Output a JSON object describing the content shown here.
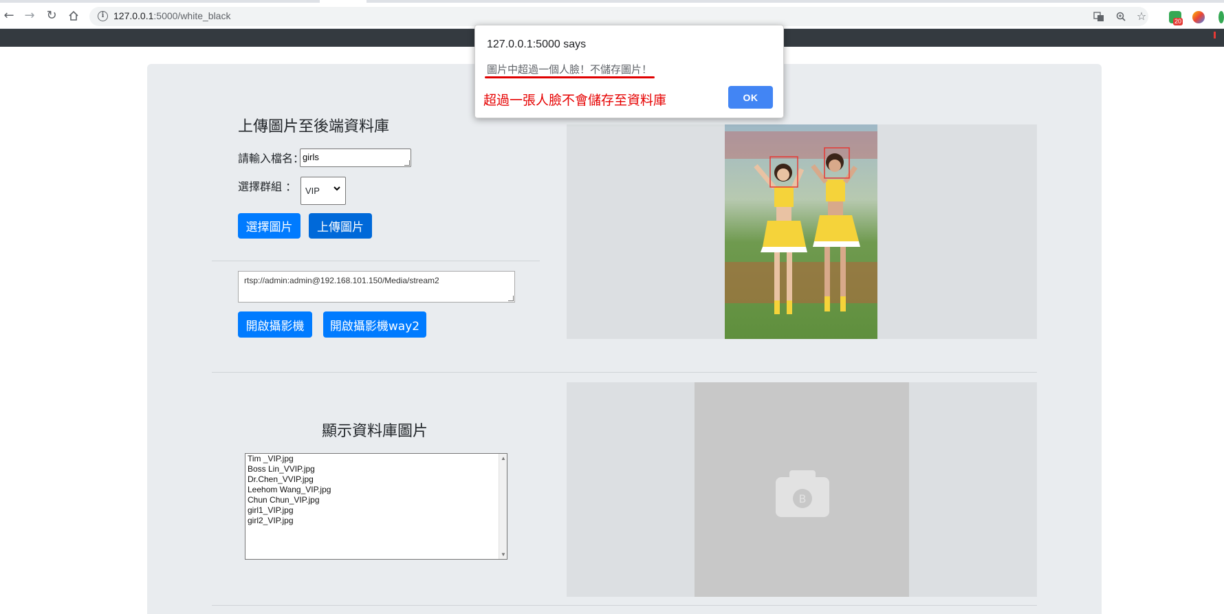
{
  "browser": {
    "url_host": "127.0.0.1",
    "url_path": ":5000/white_black",
    "extension_badge": "20",
    "icons": [
      "back-arrow-icon",
      "forward-arrow-icon",
      "reload-icon",
      "home-icon",
      "info-icon",
      "translate-icon",
      "zoom-icon",
      "star-icon"
    ]
  },
  "upload_section": {
    "title": "上傳圖片至後端資料庫",
    "filename_label": "請輸入檔名：",
    "filename_value": "girls",
    "group_label": "選擇群組 ：",
    "group_selected": "VIP",
    "choose_button": "選擇圖片",
    "upload_button": "上傳圖片"
  },
  "camera_section": {
    "stream_url": "rtsp://admin:admin@192.168.101.150/Media/stream2",
    "open_camera_button": "開啟攝影機",
    "open_camera_way2_button": "開啟攝影機way2"
  },
  "database_section": {
    "title": "顯示資料庫圖片",
    "files": [
      "Tim _VIP.jpg",
      "Boss Lin_VVIP.jpg",
      "Dr.Chen_VVIP.jpg",
      "Leehom Wang_VIP.jpg",
      "Chun Chun_VIP.jpg",
      "girl1_VIP.jpg",
      "girl2_VIP.jpg"
    ],
    "placeholder_letter": "B"
  },
  "dialog": {
    "title": "127.0.0.1:5000 says",
    "message": "圖片中超過一個人臉！不儲存圖片！",
    "annotation": "超過一張人臉不會儲存至資料庫",
    "ok_button": "OK"
  },
  "colors": {
    "primary_button": "#007bff",
    "navbar": "#343a40",
    "container": "#e9ecef",
    "annotation_red": "#e60000",
    "face_box": "#e53935"
  }
}
